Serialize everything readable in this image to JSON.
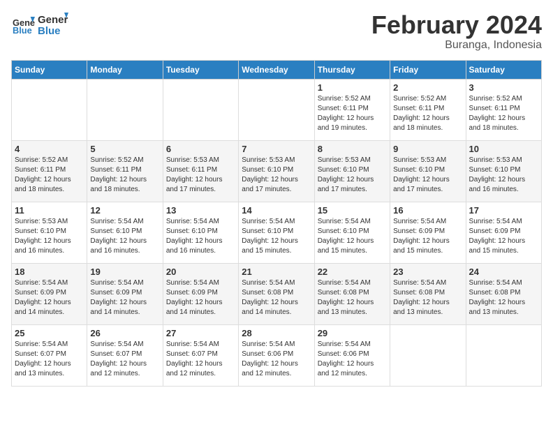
{
  "header": {
    "logo_general": "General",
    "logo_blue": "Blue",
    "title": "February 2024",
    "subtitle": "Buranga, Indonesia"
  },
  "days_of_week": [
    "Sunday",
    "Monday",
    "Tuesday",
    "Wednesday",
    "Thursday",
    "Friday",
    "Saturday"
  ],
  "weeks": [
    [
      {
        "day": "",
        "info": ""
      },
      {
        "day": "",
        "info": ""
      },
      {
        "day": "",
        "info": ""
      },
      {
        "day": "",
        "info": ""
      },
      {
        "day": "1",
        "info": "Sunrise: 5:52 AM\nSunset: 6:11 PM\nDaylight: 12 hours\nand 19 minutes."
      },
      {
        "day": "2",
        "info": "Sunrise: 5:52 AM\nSunset: 6:11 PM\nDaylight: 12 hours\nand 18 minutes."
      },
      {
        "day": "3",
        "info": "Sunrise: 5:52 AM\nSunset: 6:11 PM\nDaylight: 12 hours\nand 18 minutes."
      }
    ],
    [
      {
        "day": "4",
        "info": "Sunrise: 5:52 AM\nSunset: 6:11 PM\nDaylight: 12 hours\nand 18 minutes."
      },
      {
        "day": "5",
        "info": "Sunrise: 5:52 AM\nSunset: 6:11 PM\nDaylight: 12 hours\nand 18 minutes."
      },
      {
        "day": "6",
        "info": "Sunrise: 5:53 AM\nSunset: 6:11 PM\nDaylight: 12 hours\nand 17 minutes."
      },
      {
        "day": "7",
        "info": "Sunrise: 5:53 AM\nSunset: 6:10 PM\nDaylight: 12 hours\nand 17 minutes."
      },
      {
        "day": "8",
        "info": "Sunrise: 5:53 AM\nSunset: 6:10 PM\nDaylight: 12 hours\nand 17 minutes."
      },
      {
        "day": "9",
        "info": "Sunrise: 5:53 AM\nSunset: 6:10 PM\nDaylight: 12 hours\nand 17 minutes."
      },
      {
        "day": "10",
        "info": "Sunrise: 5:53 AM\nSunset: 6:10 PM\nDaylight: 12 hours\nand 16 minutes."
      }
    ],
    [
      {
        "day": "11",
        "info": "Sunrise: 5:53 AM\nSunset: 6:10 PM\nDaylight: 12 hours\nand 16 minutes."
      },
      {
        "day": "12",
        "info": "Sunrise: 5:54 AM\nSunset: 6:10 PM\nDaylight: 12 hours\nand 16 minutes."
      },
      {
        "day": "13",
        "info": "Sunrise: 5:54 AM\nSunset: 6:10 PM\nDaylight: 12 hours\nand 16 minutes."
      },
      {
        "day": "14",
        "info": "Sunrise: 5:54 AM\nSunset: 6:10 PM\nDaylight: 12 hours\nand 15 minutes."
      },
      {
        "day": "15",
        "info": "Sunrise: 5:54 AM\nSunset: 6:10 PM\nDaylight: 12 hours\nand 15 minutes."
      },
      {
        "day": "16",
        "info": "Sunrise: 5:54 AM\nSunset: 6:09 PM\nDaylight: 12 hours\nand 15 minutes."
      },
      {
        "day": "17",
        "info": "Sunrise: 5:54 AM\nSunset: 6:09 PM\nDaylight: 12 hours\nand 15 minutes."
      }
    ],
    [
      {
        "day": "18",
        "info": "Sunrise: 5:54 AM\nSunset: 6:09 PM\nDaylight: 12 hours\nand 14 minutes."
      },
      {
        "day": "19",
        "info": "Sunrise: 5:54 AM\nSunset: 6:09 PM\nDaylight: 12 hours\nand 14 minutes."
      },
      {
        "day": "20",
        "info": "Sunrise: 5:54 AM\nSunset: 6:09 PM\nDaylight: 12 hours\nand 14 minutes."
      },
      {
        "day": "21",
        "info": "Sunrise: 5:54 AM\nSunset: 6:08 PM\nDaylight: 12 hours\nand 14 minutes."
      },
      {
        "day": "22",
        "info": "Sunrise: 5:54 AM\nSunset: 6:08 PM\nDaylight: 12 hours\nand 13 minutes."
      },
      {
        "day": "23",
        "info": "Sunrise: 5:54 AM\nSunset: 6:08 PM\nDaylight: 12 hours\nand 13 minutes."
      },
      {
        "day": "24",
        "info": "Sunrise: 5:54 AM\nSunset: 6:08 PM\nDaylight: 12 hours\nand 13 minutes."
      }
    ],
    [
      {
        "day": "25",
        "info": "Sunrise: 5:54 AM\nSunset: 6:07 PM\nDaylight: 12 hours\nand 13 minutes."
      },
      {
        "day": "26",
        "info": "Sunrise: 5:54 AM\nSunset: 6:07 PM\nDaylight: 12 hours\nand 12 minutes."
      },
      {
        "day": "27",
        "info": "Sunrise: 5:54 AM\nSunset: 6:07 PM\nDaylight: 12 hours\nand 12 minutes."
      },
      {
        "day": "28",
        "info": "Sunrise: 5:54 AM\nSunset: 6:06 PM\nDaylight: 12 hours\nand 12 minutes."
      },
      {
        "day": "29",
        "info": "Sunrise: 5:54 AM\nSunset: 6:06 PM\nDaylight: 12 hours\nand 12 minutes."
      },
      {
        "day": "",
        "info": ""
      },
      {
        "day": "",
        "info": ""
      }
    ]
  ]
}
